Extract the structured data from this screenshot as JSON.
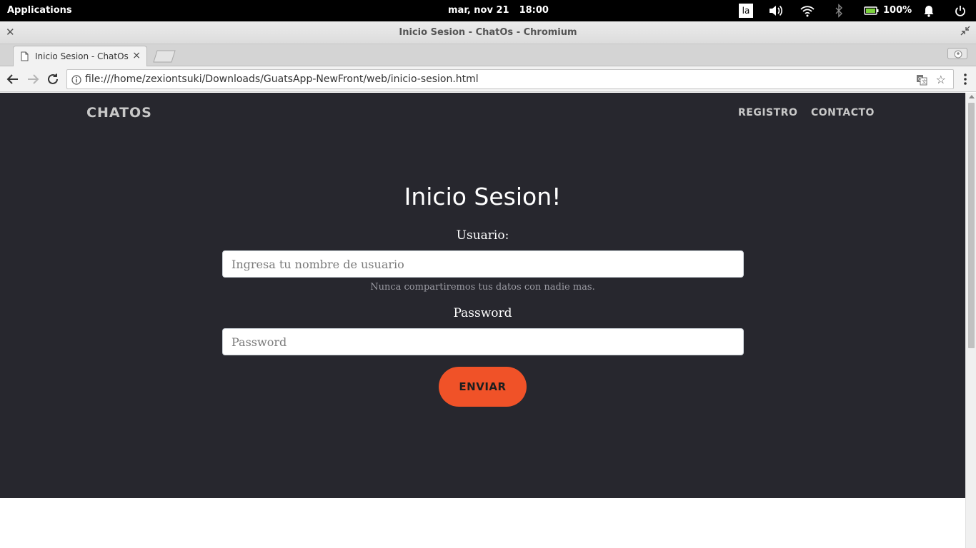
{
  "system_bar": {
    "applications": "Applications",
    "date": "mar, nov 21",
    "time": "18:00",
    "keyboard_layout": "la",
    "battery": "100%",
    "icons": [
      "volume-icon",
      "wifi-icon",
      "bluetooth-icon",
      "battery-icon",
      "notification-bell-icon",
      "power-icon"
    ]
  },
  "window": {
    "title": "Inicio Sesion - ChatOs - Chromium"
  },
  "browser": {
    "tab_title": "Inicio Sesion - ChatOs",
    "url": "file:///home/zexiontsuki/Downloads/GuatsApp-NewFront/web/inicio-sesion.html"
  },
  "page": {
    "brand": "CHATOS",
    "nav": {
      "registro": "REGISTRO",
      "contacto": "CONTACTO"
    },
    "heading": "Inicio Sesion!",
    "form": {
      "user_label": "Usuario:",
      "user_placeholder": "Ingresa tu nombre de usuario",
      "user_help": "Nunca compartiremos tus datos con nadie mas.",
      "password_label": "Password",
      "password_placeholder": "Password",
      "submit_label": "ENVIAR"
    }
  },
  "colors": {
    "page_background": "#27272e",
    "accent": "#f05228"
  }
}
